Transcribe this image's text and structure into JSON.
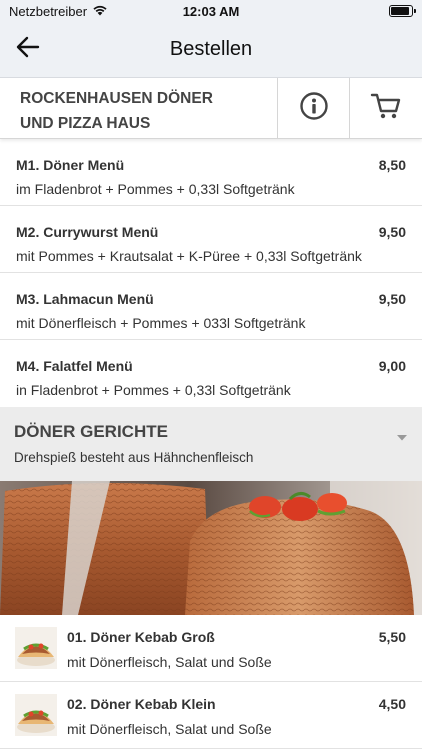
{
  "status_bar": {
    "carrier": "Netzbetreiber",
    "time": "12:03 AM",
    "battery_level": 0.9
  },
  "nav": {
    "title": "Bestellen",
    "back_icon": "arrow-left-icon"
  },
  "shop": {
    "name_line1": "ROCKENHAUSEN DÖNER",
    "name_line2": "UND PIZZA HAUS",
    "info_icon": "info-icon",
    "cart_icon": "cart-icon"
  },
  "menus": [
    {
      "name": "M1. Döner Menü",
      "price": "8,50",
      "description": "im Fladenbrot + Pommes + 0,33l Softgetränk"
    },
    {
      "name": "M2. Currywurst Menü",
      "price": "9,50",
      "description": "mit Pommes + Krautsalat + K-Püree + 0,33l Softgetränk"
    },
    {
      "name": "M3. Lahmacun Menü",
      "price": "9,50",
      "description": "mit Dönerfleisch + Pommes + 033l Softgetränk"
    },
    {
      "name": "M4. Falatfel Menü",
      "price": "9,00",
      "description": "in Fladenbrot + Pommes + 0,33l Softgetränk"
    }
  ],
  "section": {
    "title": "DÖNER GERICHTE",
    "subtitle": "Drehspieß besteht aus Hähnchenfleisch",
    "chevron_icon": "chevron-down-icon"
  },
  "items": [
    {
      "name": "01. Döner Kebab Groß",
      "price": "5,50",
      "description": "mit Dönerfleisch, Salat und Soße"
    },
    {
      "name": "02. Döner Kebab Klein",
      "price": "4,50",
      "description": "mit Dönerfleisch, Salat und Soße"
    }
  ],
  "colors": {
    "header_bg": "#eef1f5",
    "section_bg": "#ececec",
    "text": "#333333"
  }
}
